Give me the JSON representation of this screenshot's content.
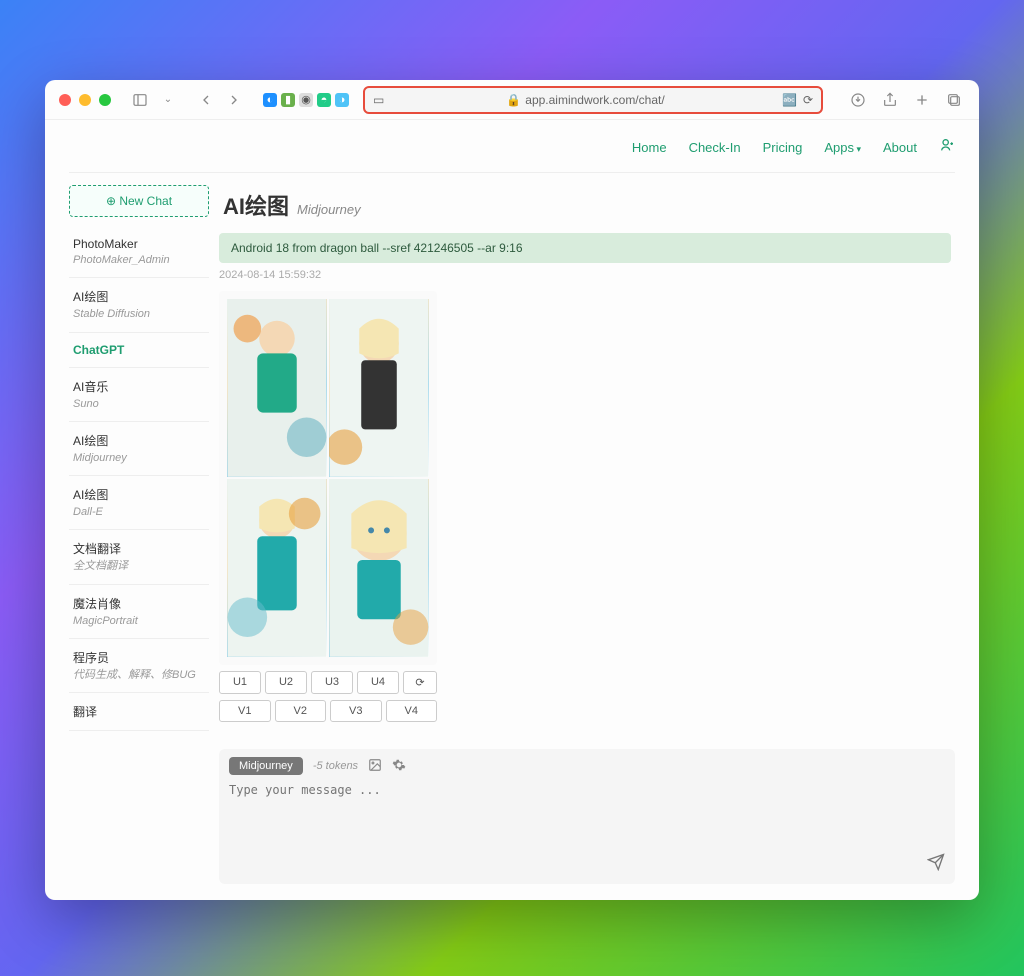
{
  "browser": {
    "url": "app.aimindwork.com/chat/"
  },
  "nav": {
    "home": "Home",
    "checkin": "Check-In",
    "pricing": "Pricing",
    "apps": "Apps",
    "about": "About"
  },
  "sidebar": {
    "newchat": "⊕ New Chat",
    "items": [
      {
        "title": "PhotoMaker",
        "subtitle": "PhotoMaker_Admin"
      },
      {
        "title": "AI绘图",
        "subtitle": "Stable Diffusion"
      },
      {
        "title": "ChatGPT",
        "subtitle": ""
      },
      {
        "title": "AI音乐",
        "subtitle": "Suno"
      },
      {
        "title": "AI绘图",
        "subtitle": "Midjourney"
      },
      {
        "title": "AI绘图",
        "subtitle": "Dall-E"
      },
      {
        "title": "文档翻译",
        "subtitle": "全文档翻译"
      },
      {
        "title": "魔法肖像",
        "subtitle": "MagicPortrait"
      },
      {
        "title": "程序员",
        "subtitle": "代码生成、解释、修BUG"
      },
      {
        "title": "翻译",
        "subtitle": ""
      }
    ],
    "activeIndex": 2
  },
  "main": {
    "title": "AI绘图",
    "subtitle": "Midjourney",
    "prompt": "Android 18 from dragon ball --sref 421246505 --ar 9:16",
    "timestamp": "2024-08-14 15:59:32",
    "buttons_u": [
      "U1",
      "U2",
      "U3",
      "U4"
    ],
    "buttons_v": [
      "V1",
      "V2",
      "V3",
      "V4"
    ]
  },
  "input": {
    "badge": "Midjourney",
    "tokens": "-5 tokens",
    "placeholder": "Type your message ..."
  }
}
